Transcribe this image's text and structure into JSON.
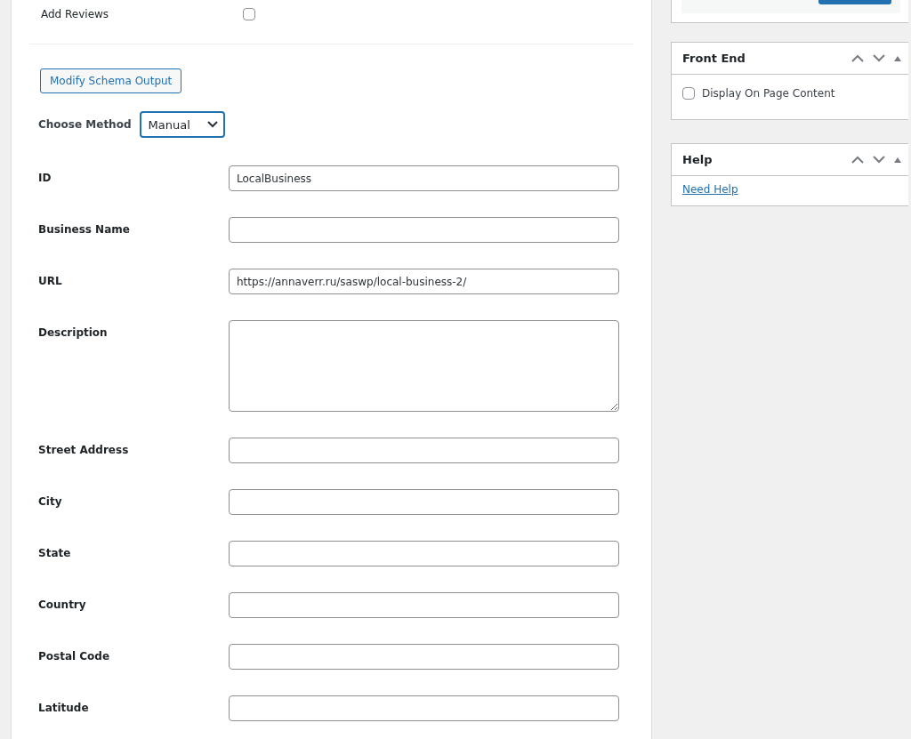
{
  "add_reviews": {
    "label": "Add Reviews",
    "checked": false
  },
  "modify_button": "Modify Schema Output",
  "method": {
    "label": "Choose Method",
    "value": "Manual"
  },
  "fields": [
    {
      "kind": "input",
      "label": "ID",
      "value": "LocalBusiness"
    },
    {
      "kind": "input",
      "label": "Business Name"
    },
    {
      "kind": "input",
      "label": "URL",
      "value": "https://annaverr.ru/saswp/local-business-2/"
    },
    {
      "kind": "textarea",
      "label": "Description"
    },
    {
      "kind": "input",
      "label": "Street Address"
    },
    {
      "kind": "input",
      "label": "City"
    },
    {
      "kind": "input",
      "label": "State"
    },
    {
      "kind": "input",
      "label": "Country"
    },
    {
      "kind": "input",
      "label": "Postal Code"
    },
    {
      "kind": "input",
      "label": "Latitude"
    }
  ],
  "sidebar": [
    {
      "title": "Front End",
      "kind": "checkbox",
      "label": "Display On Page Content",
      "checked": false
    },
    {
      "title": "Help",
      "kind": "link",
      "label": "Need Help"
    }
  ]
}
